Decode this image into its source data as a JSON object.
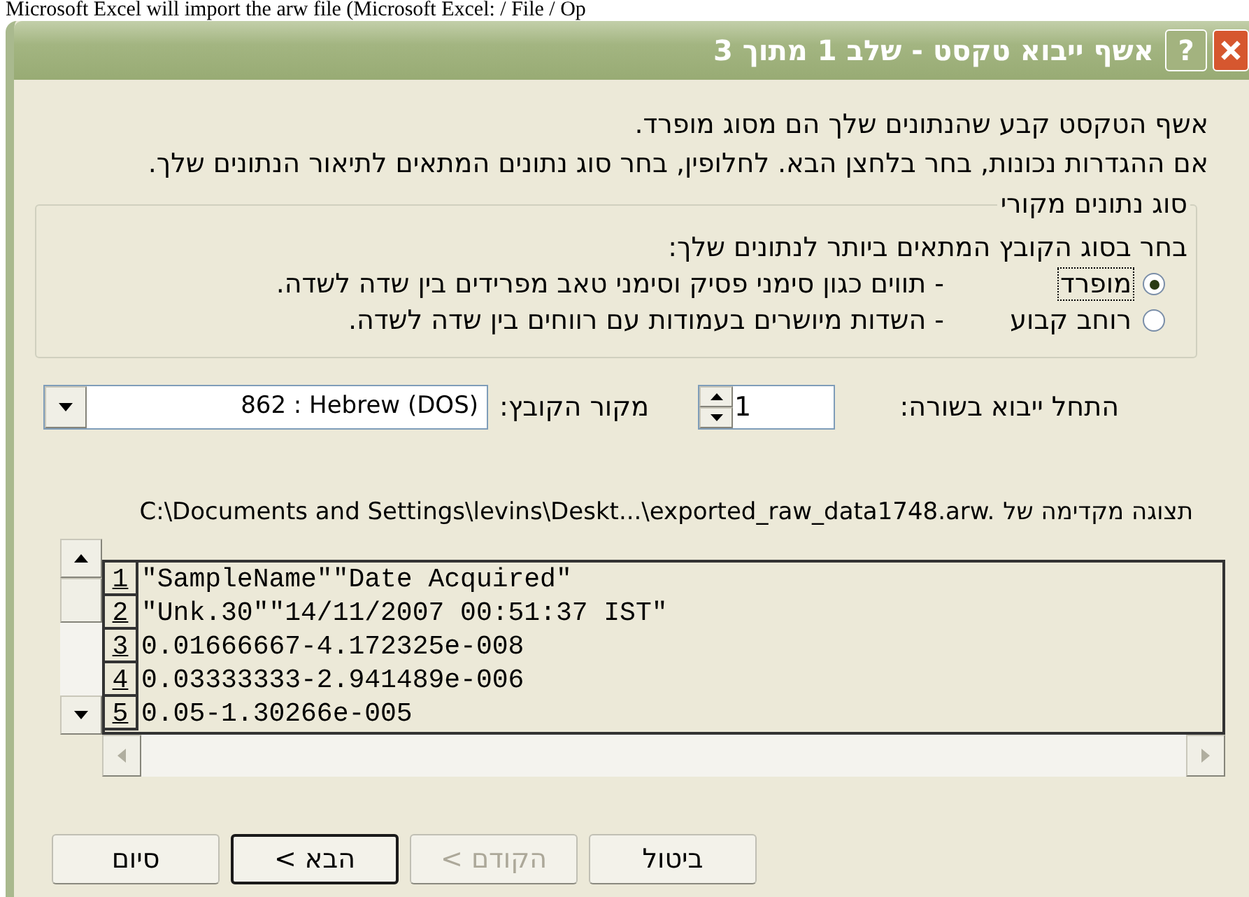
{
  "top_caption": "Microsoft Excel will import the arw file (Microsoft Excel: / File / Op",
  "window": {
    "title": "אשף ייבוא טקסט - שלב 1 מתוך 3",
    "help_button": "?"
  },
  "intro": [
    "אשף הטקסט קבע שהנתונים שלך הם מסוג מופרד.",
    "אם ההגדרות נכונות, בחר בלחצן הבא. לחלופין, בחר סוג נתונים המתאים לתיאור הנתונים שלך."
  ],
  "data_type_group": {
    "title": "סוג נתונים מקורי",
    "prompt": "בחר בסוג הקובץ המתאים ביותר לנתונים שלך:",
    "options": [
      {
        "label": "מופרד",
        "description": "- תווים כגון סימני פסיק וסימני טאב מפרידים בין שדה לשדה.",
        "selected": true
      },
      {
        "label": "רוחב קבוע",
        "description": "- השדות מיושרים בעמודות עם רווחים בין שדה לשדה.",
        "selected": false
      }
    ]
  },
  "start_row": {
    "label": "התחל ייבוא בשורה:",
    "value": "1"
  },
  "file_origin": {
    "label": "מקור הקובץ:",
    "value": "862 : Hebrew (DOS)"
  },
  "preview": {
    "label": "תצוגה מקדימה של",
    "path": "C:\\Documents and Settings\\levins\\Deskt...\\exported_raw_data1748.arw.",
    "rows": [
      {
        "num": "1",
        "text": "\"SampleName\"\"Date Acquired\""
      },
      {
        "num": "2",
        "text": "\"Unk.30\"\"14/11/2007 00:51:37 IST\""
      },
      {
        "num": "3",
        "text": "0.01666667-4.172325e-008"
      },
      {
        "num": "4",
        "text": "0.03333333-2.941489e-006"
      },
      {
        "num": "5",
        "text": "0.05-1.30266e-005"
      }
    ]
  },
  "buttons": [
    {
      "label": "ביטול",
      "disabled": false,
      "default": false
    },
    {
      "label": "< הקודם",
      "disabled": true,
      "default": false
    },
    {
      "label": "< הבא",
      "disabled": false,
      "default": true
    },
    {
      "label": "סיום",
      "disabled": false,
      "default": false
    }
  ]
}
